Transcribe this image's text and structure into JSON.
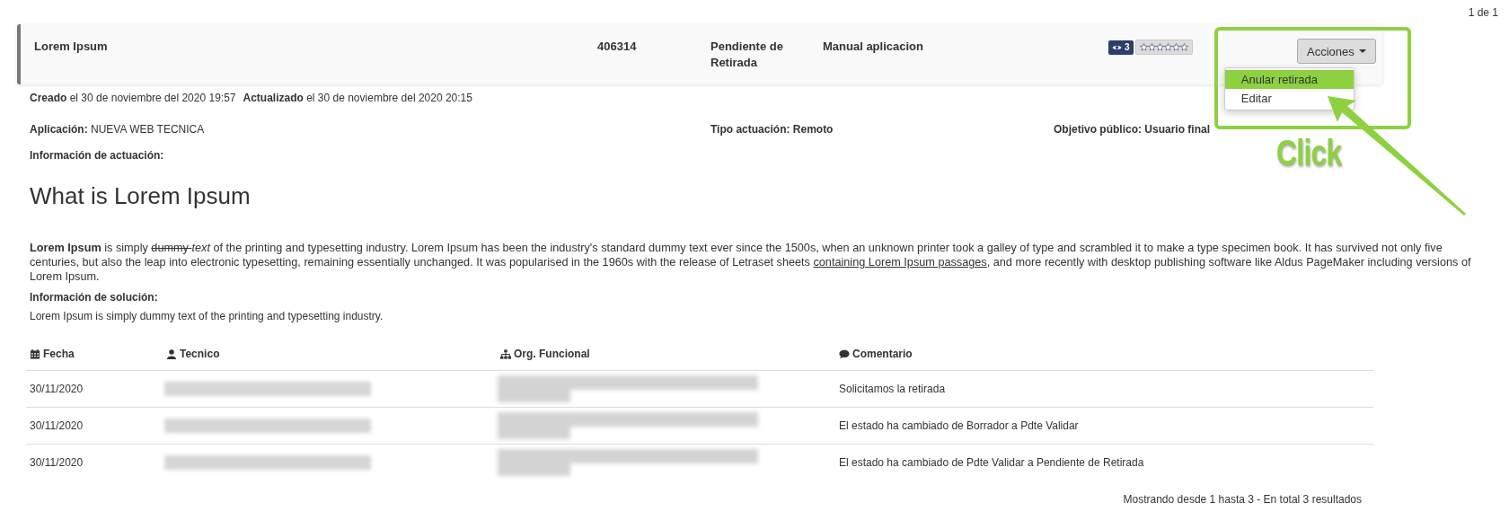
{
  "pager": "1 de 1",
  "record": {
    "title": "Lorem Ipsum",
    "number": "406314",
    "status": "Pendiente de Retirada",
    "type": "Manual aplicacion",
    "views": "3",
    "stars": 0,
    "actions_button": "Acciones",
    "actions_menu": [
      {
        "label": "Anular retirada",
        "selected": true
      },
      {
        "label": "Editar",
        "selected": false
      }
    ]
  },
  "meta": [
    "**Creado** el 30 de noviembre del 2020 19:57",
    "**Actualizado** el 30 de noviembre del 2020 20:15"
  ],
  "fields": [
    {
      "kind": "mixed",
      "text": "**Aplicación:** NUEVA WEB TECNICA"
    },
    {
      "kind": "bold",
      "text": "Tipo actuación: Remoto"
    },
    {
      "kind": "bold",
      "text": "Objetivo público: Usuario final"
    }
  ],
  "actuacion_label": "Información de actuación:",
  "heading": "What is Lorem Ipsum",
  "description": [
    {
      "kind": "bold",
      "text": "Lorem Ipsum"
    },
    {
      "kind": "plain",
      "text": " is simply "
    },
    {
      "kind": "strike",
      "text": "dummy "
    },
    {
      "kind": "italic",
      "text": "text"
    },
    {
      "kind": "plain",
      "text": " of the printing and typesetting industry. Lorem Ipsum has been the industry's standard dummy text ever since the 1500s, when an unknown printer took a galley of type and scrambled it to make a type specimen book. It has survived not only five centuries, but also the leap into electronic typesetting, remaining essentially unchanged. It was popularised in the 1960s with the release of Letraset sheets "
    },
    {
      "kind": "link",
      "text": "containing Lorem Ipsum passages"
    },
    {
      "kind": "plain",
      "text": ", and more recently with desktop publishing software like Aldus PageMaker including versions of Lorem Ipsum."
    }
  ],
  "solucion_label": "Información de solución:",
  "solucion_text": "Lorem Ipsum is simply dummy text of the printing and typesetting industry.",
  "table": {
    "columns": [
      "Fecha",
      "Tecnico",
      "Org. Funcional",
      "Comentario"
    ],
    "rows": [
      {
        "fecha": "30/11/2020",
        "tecnico_redacted": true,
        "org_redacted": true,
        "comentario": "Solicitamos la retirada"
      },
      {
        "fecha": "30/11/2020",
        "tecnico_redacted": true,
        "org_redacted": true,
        "comentario": "El estado ha cambiado de Borrador a Pdte Validar"
      },
      {
        "fecha": "30/11/2020",
        "tecnico_redacted": true,
        "org_redacted": true,
        "comentario": "El estado ha cambiado de Pdte Validar a Pendiente de Retirada"
      }
    ]
  },
  "footer": "Mostrando desde 1 hasta 3 - En total 3 resultados",
  "annotation": {
    "label": "Click"
  }
}
